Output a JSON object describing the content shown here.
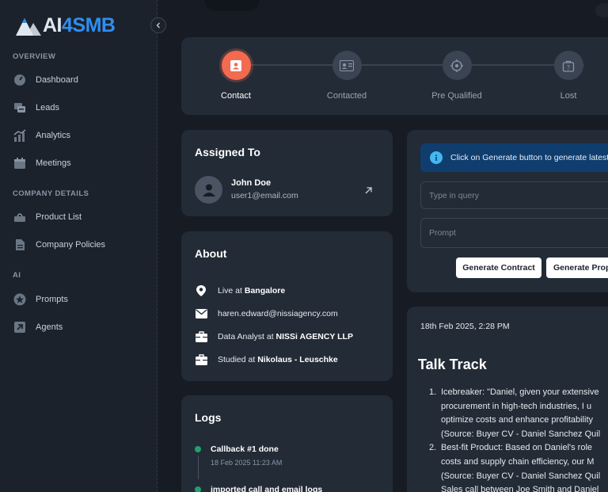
{
  "brand": {
    "part1": "AI",
    "part2": "4SMB"
  },
  "sidebar": {
    "sections": [
      {
        "label": "OVERVIEW"
      },
      {
        "label": "COMPANY DETAILS"
      },
      {
        "label": "AI"
      }
    ],
    "items": [
      {
        "label": "Dashboard",
        "icon": "gauge-icon"
      },
      {
        "label": "Leads",
        "icon": "chat-icon"
      },
      {
        "label": "Analytics",
        "icon": "chart-icon"
      },
      {
        "label": "Meetings",
        "icon": "calendar-icon"
      },
      {
        "label": "Product List",
        "icon": "basket-icon"
      },
      {
        "label": "Company Policies",
        "icon": "document-icon"
      },
      {
        "label": "Prompts",
        "icon": "star-icon"
      },
      {
        "label": "Agents",
        "icon": "arrow-box-icon"
      }
    ]
  },
  "stepper": {
    "steps": [
      {
        "label": "Contact",
        "active": true
      },
      {
        "label": "Contacted",
        "active": false
      },
      {
        "label": "Pre Qualified",
        "active": false
      },
      {
        "label": "Lost",
        "active": false
      }
    ]
  },
  "assigned": {
    "title": "Assigned To",
    "name": "John Doe",
    "email": "user1@email.com"
  },
  "about": {
    "title": "About",
    "location_prefix": "Live at ",
    "location": "Bangalore",
    "email": "haren.edward@nissiagency.com",
    "job_prefix": "Data Analyst at ",
    "company": "NISSi AGENCY LLP",
    "edu_prefix": "Studied at ",
    "school": "Nikolaus - Leuschke"
  },
  "logs": {
    "title": "Logs",
    "entries": [
      {
        "title": "Callback #1 done",
        "time": "18 Feb 2025 11:23 AM"
      },
      {
        "title": "imported call and email logs",
        "time": ""
      }
    ]
  },
  "generate": {
    "info": "Click on Generate button to generate latest",
    "query_placeholder": "Type in query",
    "prompt_placeholder": "Prompt",
    "contract_button": "Generate Contract",
    "proposal_button": "Generate Proposal"
  },
  "talk": {
    "date": "18th Feb 2025, 2:28 PM",
    "title": "Talk Track",
    "items": [
      {
        "num": "1.",
        "lines": [
          "Icebreaker: \"Daniel, given your extensive",
          "procurement in high-tech industries, I u",
          "optimize costs and enhance profitability",
          "(Source: Buyer CV - Daniel Sanchez Quil"
        ]
      },
      {
        "num": "2.",
        "lines": [
          "Best-fit Product: Based on Daniel's role",
          "costs and supply chain efficiency, our M",
          "(Source: Buyer CV - Daniel Sanchez Quil",
          "Sales call between Joe Smith and Daniel"
        ]
      }
    ]
  },
  "colors": {
    "accent": "#f26a4f",
    "brand_blue": "#2f8ef0",
    "success": "#22a06b",
    "info_bg": "#0f3d6e"
  }
}
